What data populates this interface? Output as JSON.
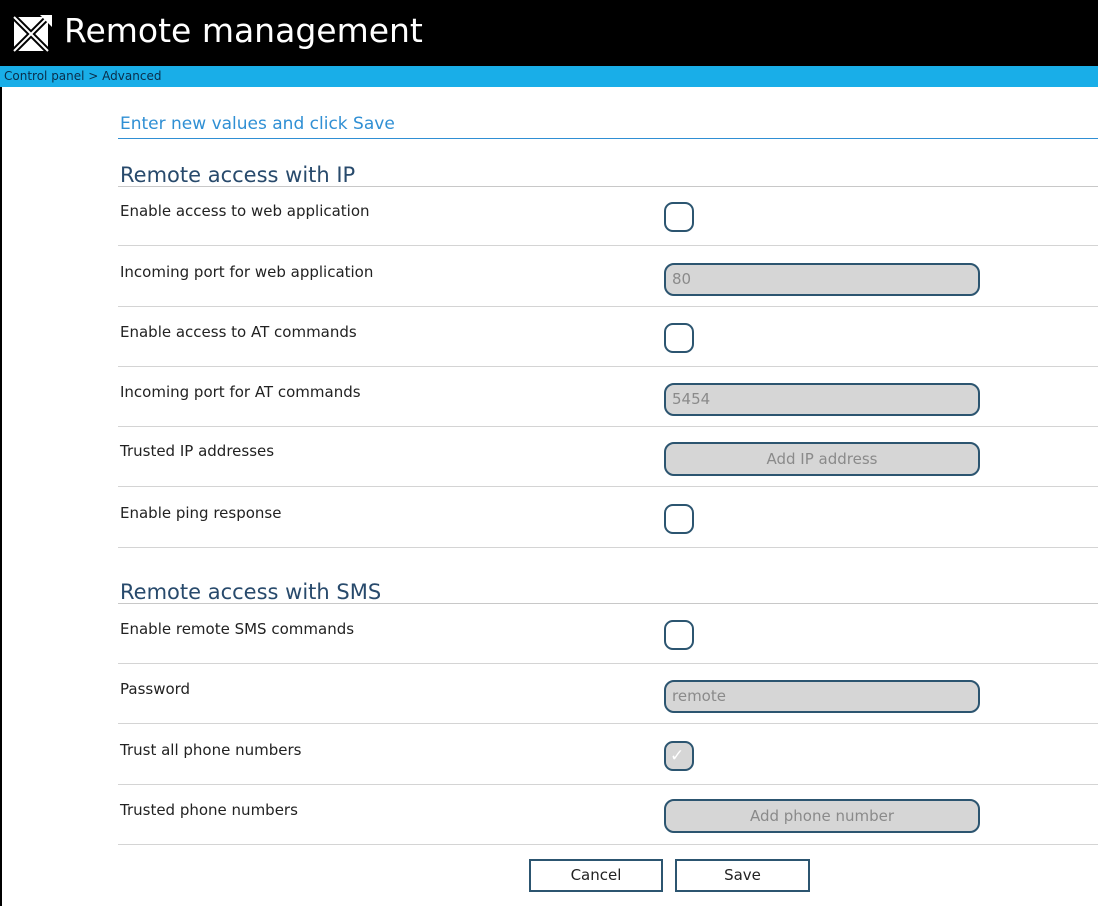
{
  "window": {
    "title": "Remote management",
    "logo_icon": "x-envelope-logo-icon"
  },
  "breadcrumb": "Control panel > Advanced",
  "intro": "Enter new values and click Save",
  "colors": {
    "header": "#000000",
    "breadcrumb_bar": "#19aee8",
    "accent": "#2f8fd4",
    "section_title": "#284a6c",
    "control_border": "#2c5570",
    "disabled_fill": "#d6d6d6"
  },
  "sections": {
    "ip": {
      "title": "Remote access with IP",
      "rows": [
        {
          "label": "Enable access to web application",
          "type": "checkbox",
          "checked": false
        },
        {
          "label": "Incoming port for web application",
          "type": "text",
          "value": "80",
          "disabled": true
        },
        {
          "label": "Enable access to AT commands",
          "type": "checkbox",
          "checked": false
        },
        {
          "label": "Incoming port for AT commands",
          "type": "text",
          "value": "5454",
          "disabled": true
        },
        {
          "label": "Trusted IP addresses",
          "type": "button",
          "button_label": "Add IP address",
          "disabled": true
        },
        {
          "label": "Enable ping response",
          "type": "checkbox",
          "checked": false
        }
      ]
    },
    "sms": {
      "title": "Remote access with SMS",
      "rows": [
        {
          "label": "Enable remote SMS commands",
          "type": "checkbox",
          "checked": false
        },
        {
          "label": "Password",
          "type": "text",
          "value": "remote",
          "disabled": true
        },
        {
          "label": "Trust all phone numbers",
          "type": "checkbox",
          "checked": true,
          "disabled": true,
          "icon": "checkmark-icon"
        },
        {
          "label": "Trusted phone numbers",
          "type": "button",
          "button_label": "Add phone number",
          "disabled": true
        }
      ]
    }
  },
  "actions": {
    "cancel": "Cancel",
    "save": "Save"
  }
}
